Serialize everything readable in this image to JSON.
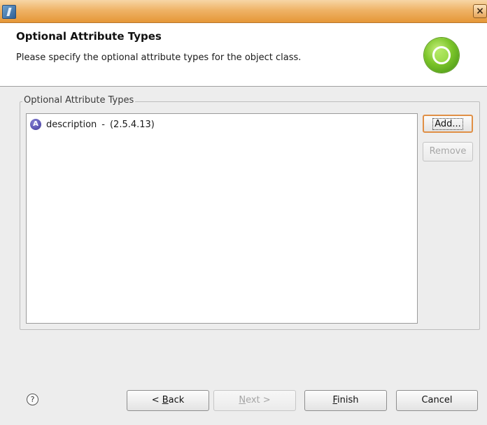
{
  "window": {
    "title": ""
  },
  "header": {
    "title": "Optional Attribute Types",
    "description": "Please specify the optional attribute types for the object class."
  },
  "group": {
    "legend": "Optional Attribute Types",
    "items": [
      {
        "icon_letter": "A",
        "name": "description",
        "separator": "-",
        "oid": "(2.5.4.13)"
      }
    ]
  },
  "buttons": {
    "add": "Add...",
    "remove": "Remove",
    "back_prefix": "< ",
    "back_mnemonic": "B",
    "back_rest": "ack",
    "next_mnemonic": "N",
    "next_rest": "ext >",
    "finish_mnemonic": "F",
    "finish_rest": "inish",
    "cancel": "Cancel"
  },
  "help": {
    "glyph": "?"
  },
  "icons": {
    "app": "dialog-app-icon",
    "close": "close-icon",
    "wizard": "object-class-wizard-icon",
    "attribute": "attribute-type-icon",
    "help": "help-icon"
  },
  "colors": {
    "titlebar": "#e59737",
    "default_button_border": "#e08f45",
    "attribute_icon": "#5c55b3",
    "wizard_icon": "#7cc52a"
  }
}
